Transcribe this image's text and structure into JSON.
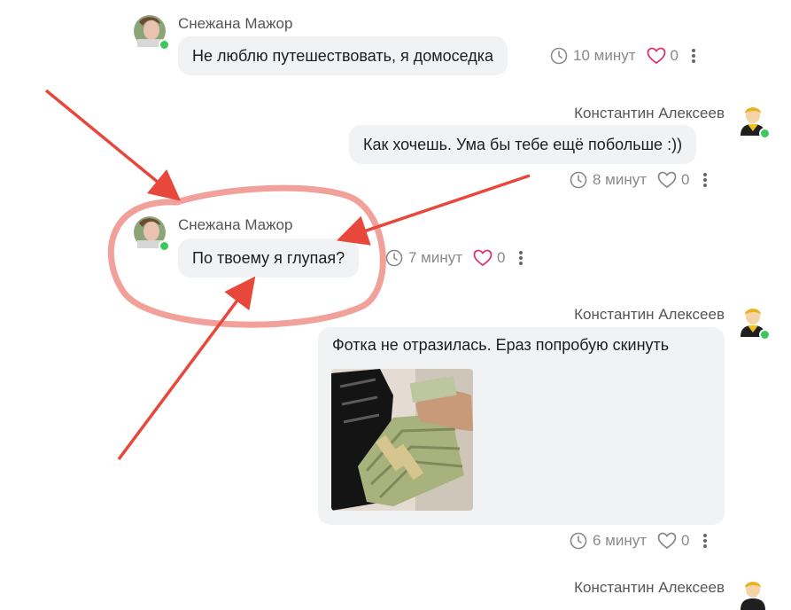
{
  "messages": [
    {
      "author": "Снежана Мажор",
      "text": "Не люблю путешествовать, я домоседка",
      "time": "10 минут",
      "likes": "0"
    },
    {
      "author": "Константин Алексеев",
      "text": "Как хочешь. Ума бы тебе ещё побольше :))",
      "time": "8 минут",
      "likes": "0"
    },
    {
      "author": "Снежана Мажор",
      "text": "По твоему я глупая?",
      "time": "7 минут",
      "likes": "0"
    },
    {
      "author": "Константин Алексеев",
      "text": "Фотка не отразилась. Ераз попробую скинуть",
      "time": "6 минут",
      "likes": "0"
    },
    {
      "author": "Константин Алексеев"
    }
  ],
  "icons": {
    "clock": "clock-icon",
    "heart": "heart-icon",
    "more": "more-vertical-icon"
  },
  "colors": {
    "annotation_arrow": "#e8473b",
    "annotation_circle": "#f1a09a",
    "heart": "#d9346b",
    "online": "#3cc85a",
    "bubble": "#f1f2f4"
  }
}
